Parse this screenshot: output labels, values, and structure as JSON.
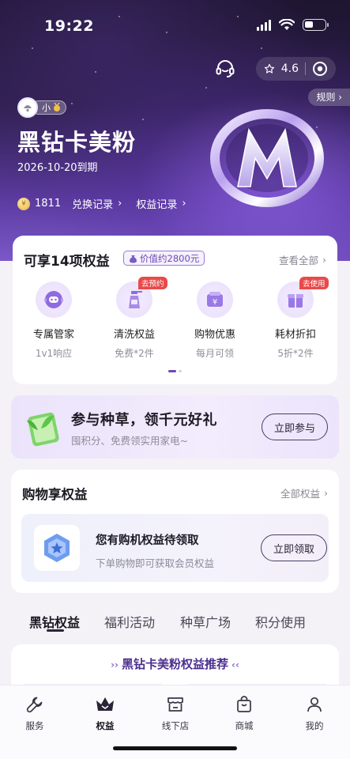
{
  "status_bar": {
    "time": "19:22"
  },
  "header": {
    "rating": "4.6",
    "rules_label": "规则",
    "member_level": "小",
    "card_title": "黑钻卡美粉",
    "expire_text": "2026-10-20到期",
    "points": "1811",
    "exchange_link": "兑换记录",
    "benefit_link": "权益记录"
  },
  "benefits": {
    "title": "可享14项权益",
    "value_tag": "价值约2800元",
    "view_all": "查看全部",
    "items": [
      {
        "name": "专属管家",
        "sub": "1v1响应",
        "badge": "",
        "icon": "robot-assistant-icon"
      },
      {
        "name": "清洗权益",
        "sub": "免费*2件",
        "badge": "去预约",
        "icon": "spray-bottle-icon"
      },
      {
        "name": "购物优惠",
        "sub": "每月可领",
        "badge": "",
        "icon": "wallet-yen-icon"
      },
      {
        "name": "耗材折扣",
        "sub": "5折*2件",
        "badge": "去使用",
        "icon": "gift-box-icon"
      }
    ]
  },
  "promo": {
    "title": "参与种草，领千元好礼",
    "subtitle": "囤积分、免费领实用家电~",
    "button": "立即参与"
  },
  "shopping": {
    "title": "购物享权益",
    "all_label": "全部权益",
    "card_title": "您有购机权益待领取",
    "card_sub": "下单购物即可获取会员权益",
    "button": "立即领取"
  },
  "tabs": [
    "黑钻权益",
    "福利活动",
    "种草广场",
    "积分使用"
  ],
  "recommend_title": "黑钻卡美粉权益推荐",
  "bottom_nav": [
    {
      "label": "服务",
      "icon": "wrench-icon"
    },
    {
      "label": "权益",
      "icon": "crown-icon"
    },
    {
      "label": "线下店",
      "icon": "store-icon"
    },
    {
      "label": "商城",
      "icon": "shopping-bag-icon"
    },
    {
      "label": "我的",
      "icon": "person-icon"
    }
  ],
  "colors": {
    "accent": "#6b4bb0",
    "badge_red": "#e84a4a",
    "hero_dark": "#1e1530"
  }
}
